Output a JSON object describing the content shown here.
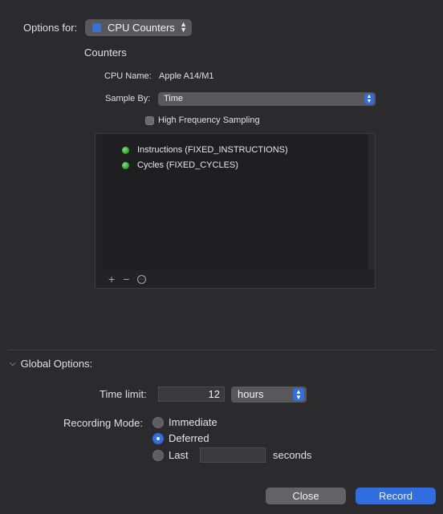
{
  "options": {
    "label": "Options for:",
    "target": "CPU Counters"
  },
  "counters": {
    "title": "Counters",
    "cpu_name_label": "CPU Name:",
    "cpu_name_value": "Apple A14/M1",
    "sample_by_label": "Sample By:",
    "sample_by_value": "Time",
    "high_freq_label": "High Frequency Sampling",
    "high_freq_checked": false,
    "items": [
      {
        "label": "Instructions (FIXED_INSTRUCTIONS)",
        "status_color": "#3cc23c"
      },
      {
        "label": "Cycles (FIXED_CYCLES)",
        "status_color": "#3cc23c"
      }
    ],
    "toolbar": {
      "add": "+",
      "remove": "−",
      "more": "···"
    }
  },
  "global": {
    "header": "Global Options:",
    "time_limit_label": "Time limit:",
    "time_limit_value": "12",
    "time_unit": "hours",
    "recording_mode_label": "Recording Mode:",
    "modes": [
      {
        "label": "Immediate",
        "selected": false
      },
      {
        "label": "Deferred",
        "selected": true
      },
      {
        "label": "Last",
        "selected": false
      }
    ],
    "last_value": "",
    "seconds_label": "seconds"
  },
  "buttons": {
    "close": "Close",
    "record": "Record"
  },
  "colors": {
    "accent": "#2f6de0",
    "background": "#2b2b2d"
  }
}
